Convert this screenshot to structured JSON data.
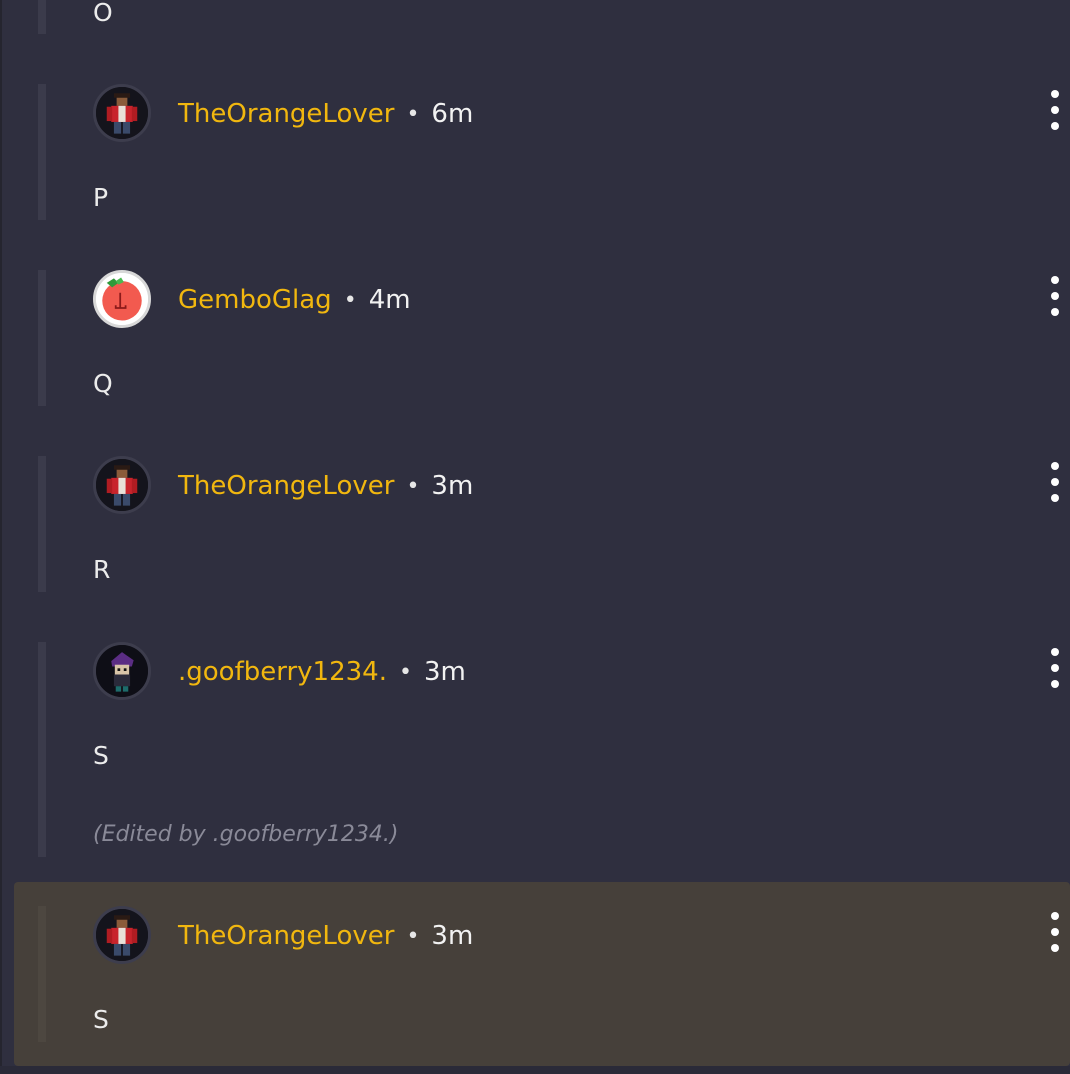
{
  "comments": [
    {
      "username": "",
      "time": "",
      "body": "O",
      "edited": ""
    },
    {
      "username": "TheOrangeLover",
      "time": "6m",
      "body": "P",
      "edited": "",
      "avatar": "redcoat-character-avatar"
    },
    {
      "username": "GemboGlag",
      "time": "4m",
      "body": "Q",
      "edited": "",
      "avatar": "red-tomato-avatar"
    },
    {
      "username": "TheOrangeLover",
      "time": "3m",
      "body": "R",
      "edited": "",
      "avatar": "redcoat-character-avatar"
    },
    {
      "username": ".goofberry1234.",
      "time": "3m",
      "body": "S",
      "edited": "(Edited by .goofberry1234.)",
      "avatar": "purple-hair-character-avatar"
    },
    {
      "username": "TheOrangeLover",
      "time": "3m",
      "body": "S",
      "edited": "",
      "avatar": "redcoat-character-avatar",
      "highlighted": true
    }
  ],
  "separator": "•",
  "colors": {
    "background": "#2f2f3f",
    "username": "#f1b70f",
    "highlight": "#46403a",
    "edited": "#8a8a98",
    "thread_line": "#3b3b4b"
  },
  "icons": {
    "menu": "more-vertical-icon"
  }
}
